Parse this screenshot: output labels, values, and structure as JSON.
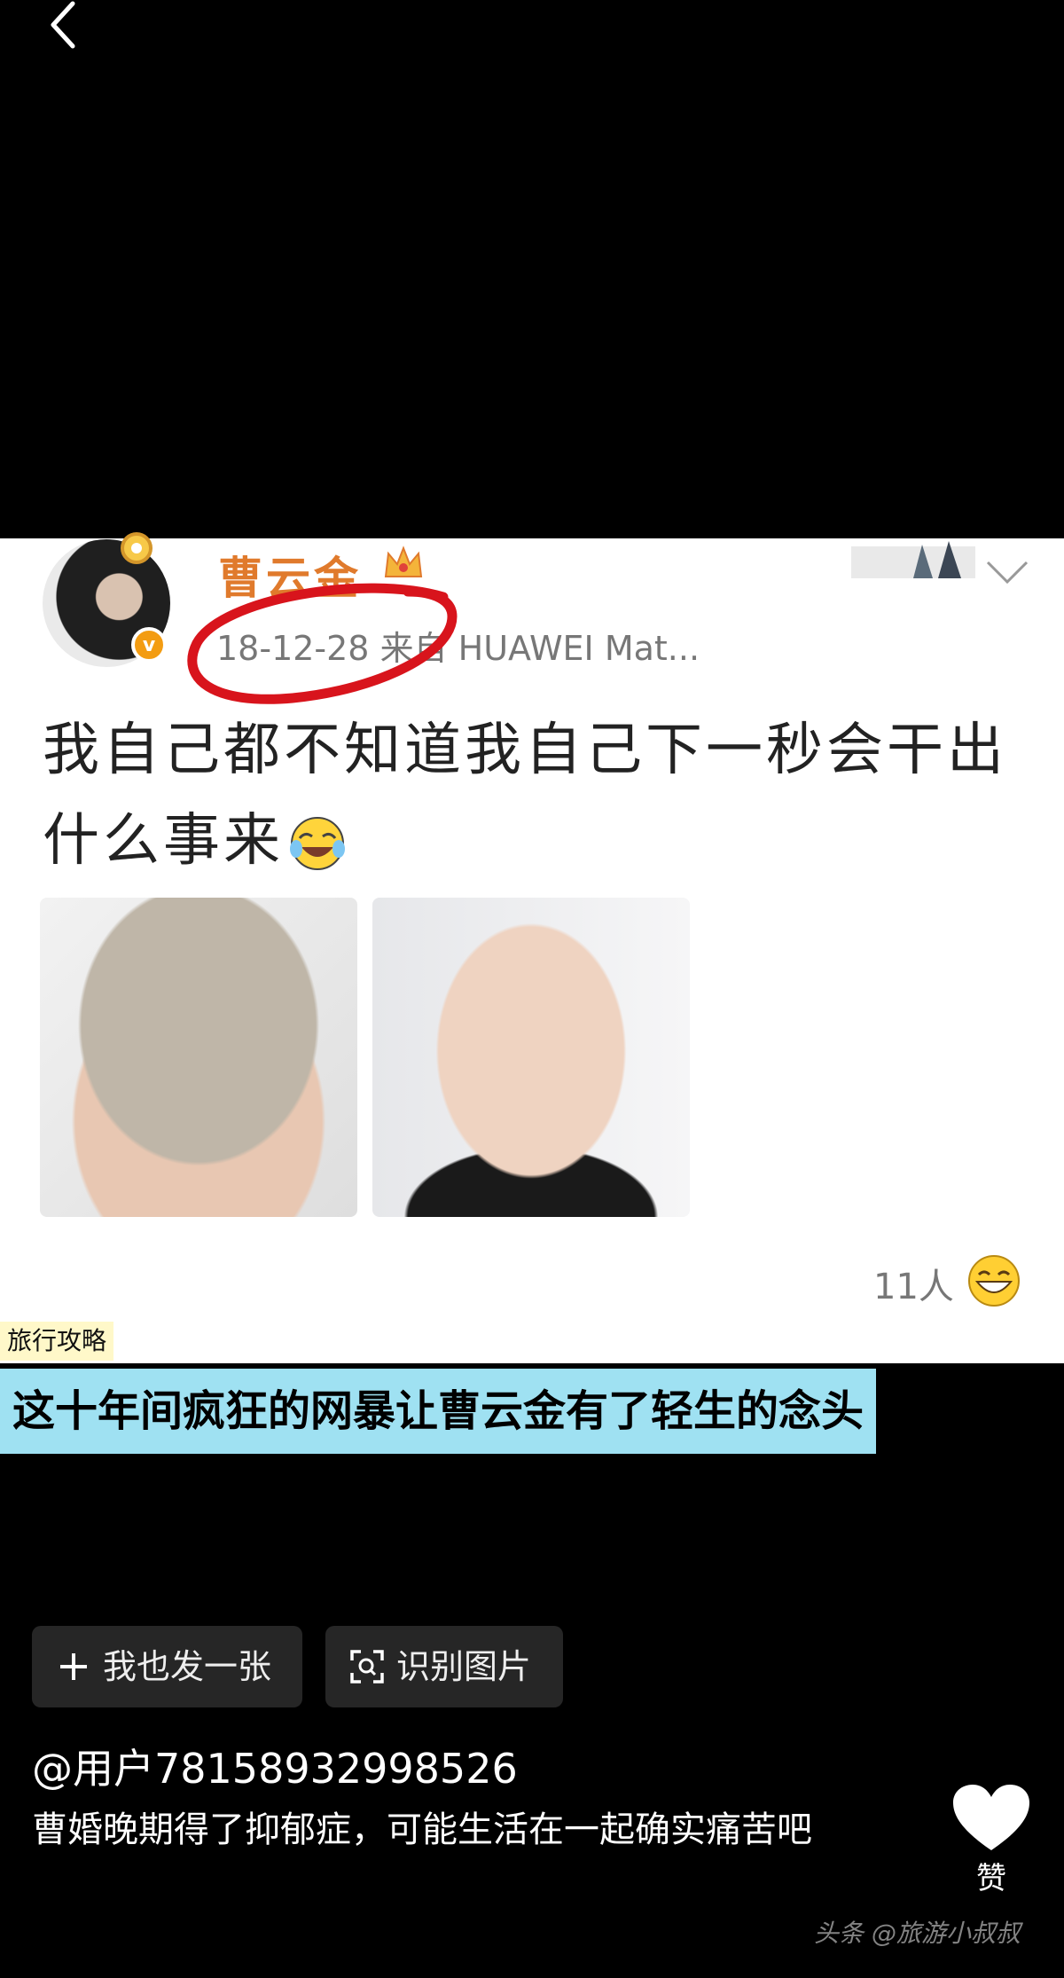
{
  "nav": {
    "back_icon": "chevron-left-icon"
  },
  "post": {
    "author": "曹云金",
    "meta": "18-12-28 来自 HUAWEI Mat...",
    "verified_mark": "v",
    "text": "我自己都不知道我自己下一秒会干出什么事来",
    "likes": "11人",
    "annotation_color": "#d8141c"
  },
  "overlay": {
    "topic_tag": "旅行攻略",
    "headline": "这十年间疯狂的网暴让曹云金有了轻生的念头"
  },
  "actions": {
    "post_one_label": "我也发一张",
    "recognize_label": "识别图片"
  },
  "comment": {
    "user": "@用户78158932998526",
    "text": "曹婚晚期得了抑郁症，可能生活在一起确实痛苦吧"
  },
  "like_button": {
    "label": "赞"
  },
  "watermark": "头条 @旅游小叔叔"
}
